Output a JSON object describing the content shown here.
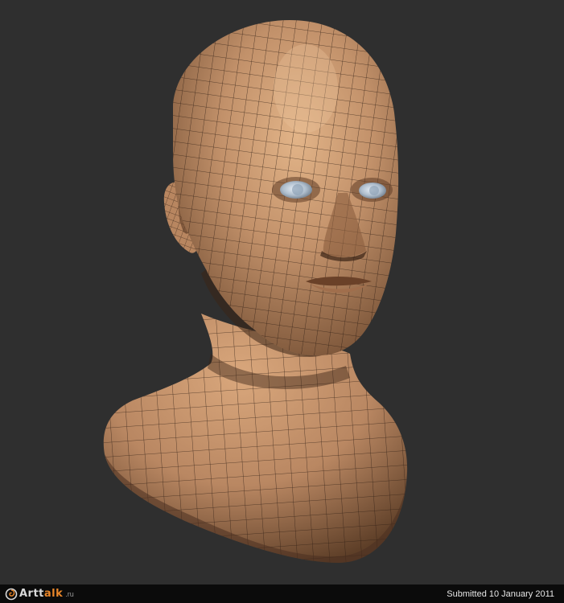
{
  "image": {
    "subject": "3d-head-bust",
    "background_color": "#2f2f2f",
    "skin_color": "#c09068",
    "eye_color": "#b8c8d8",
    "wire_color": "#2a1a10"
  },
  "footer": {
    "logo_main": "Artt",
    "logo_accent": "alk",
    "logo_suffix": ".ru",
    "logo_icon": "swirl-logo-icon",
    "submitted_text": "Submitted 10 January 2011"
  }
}
